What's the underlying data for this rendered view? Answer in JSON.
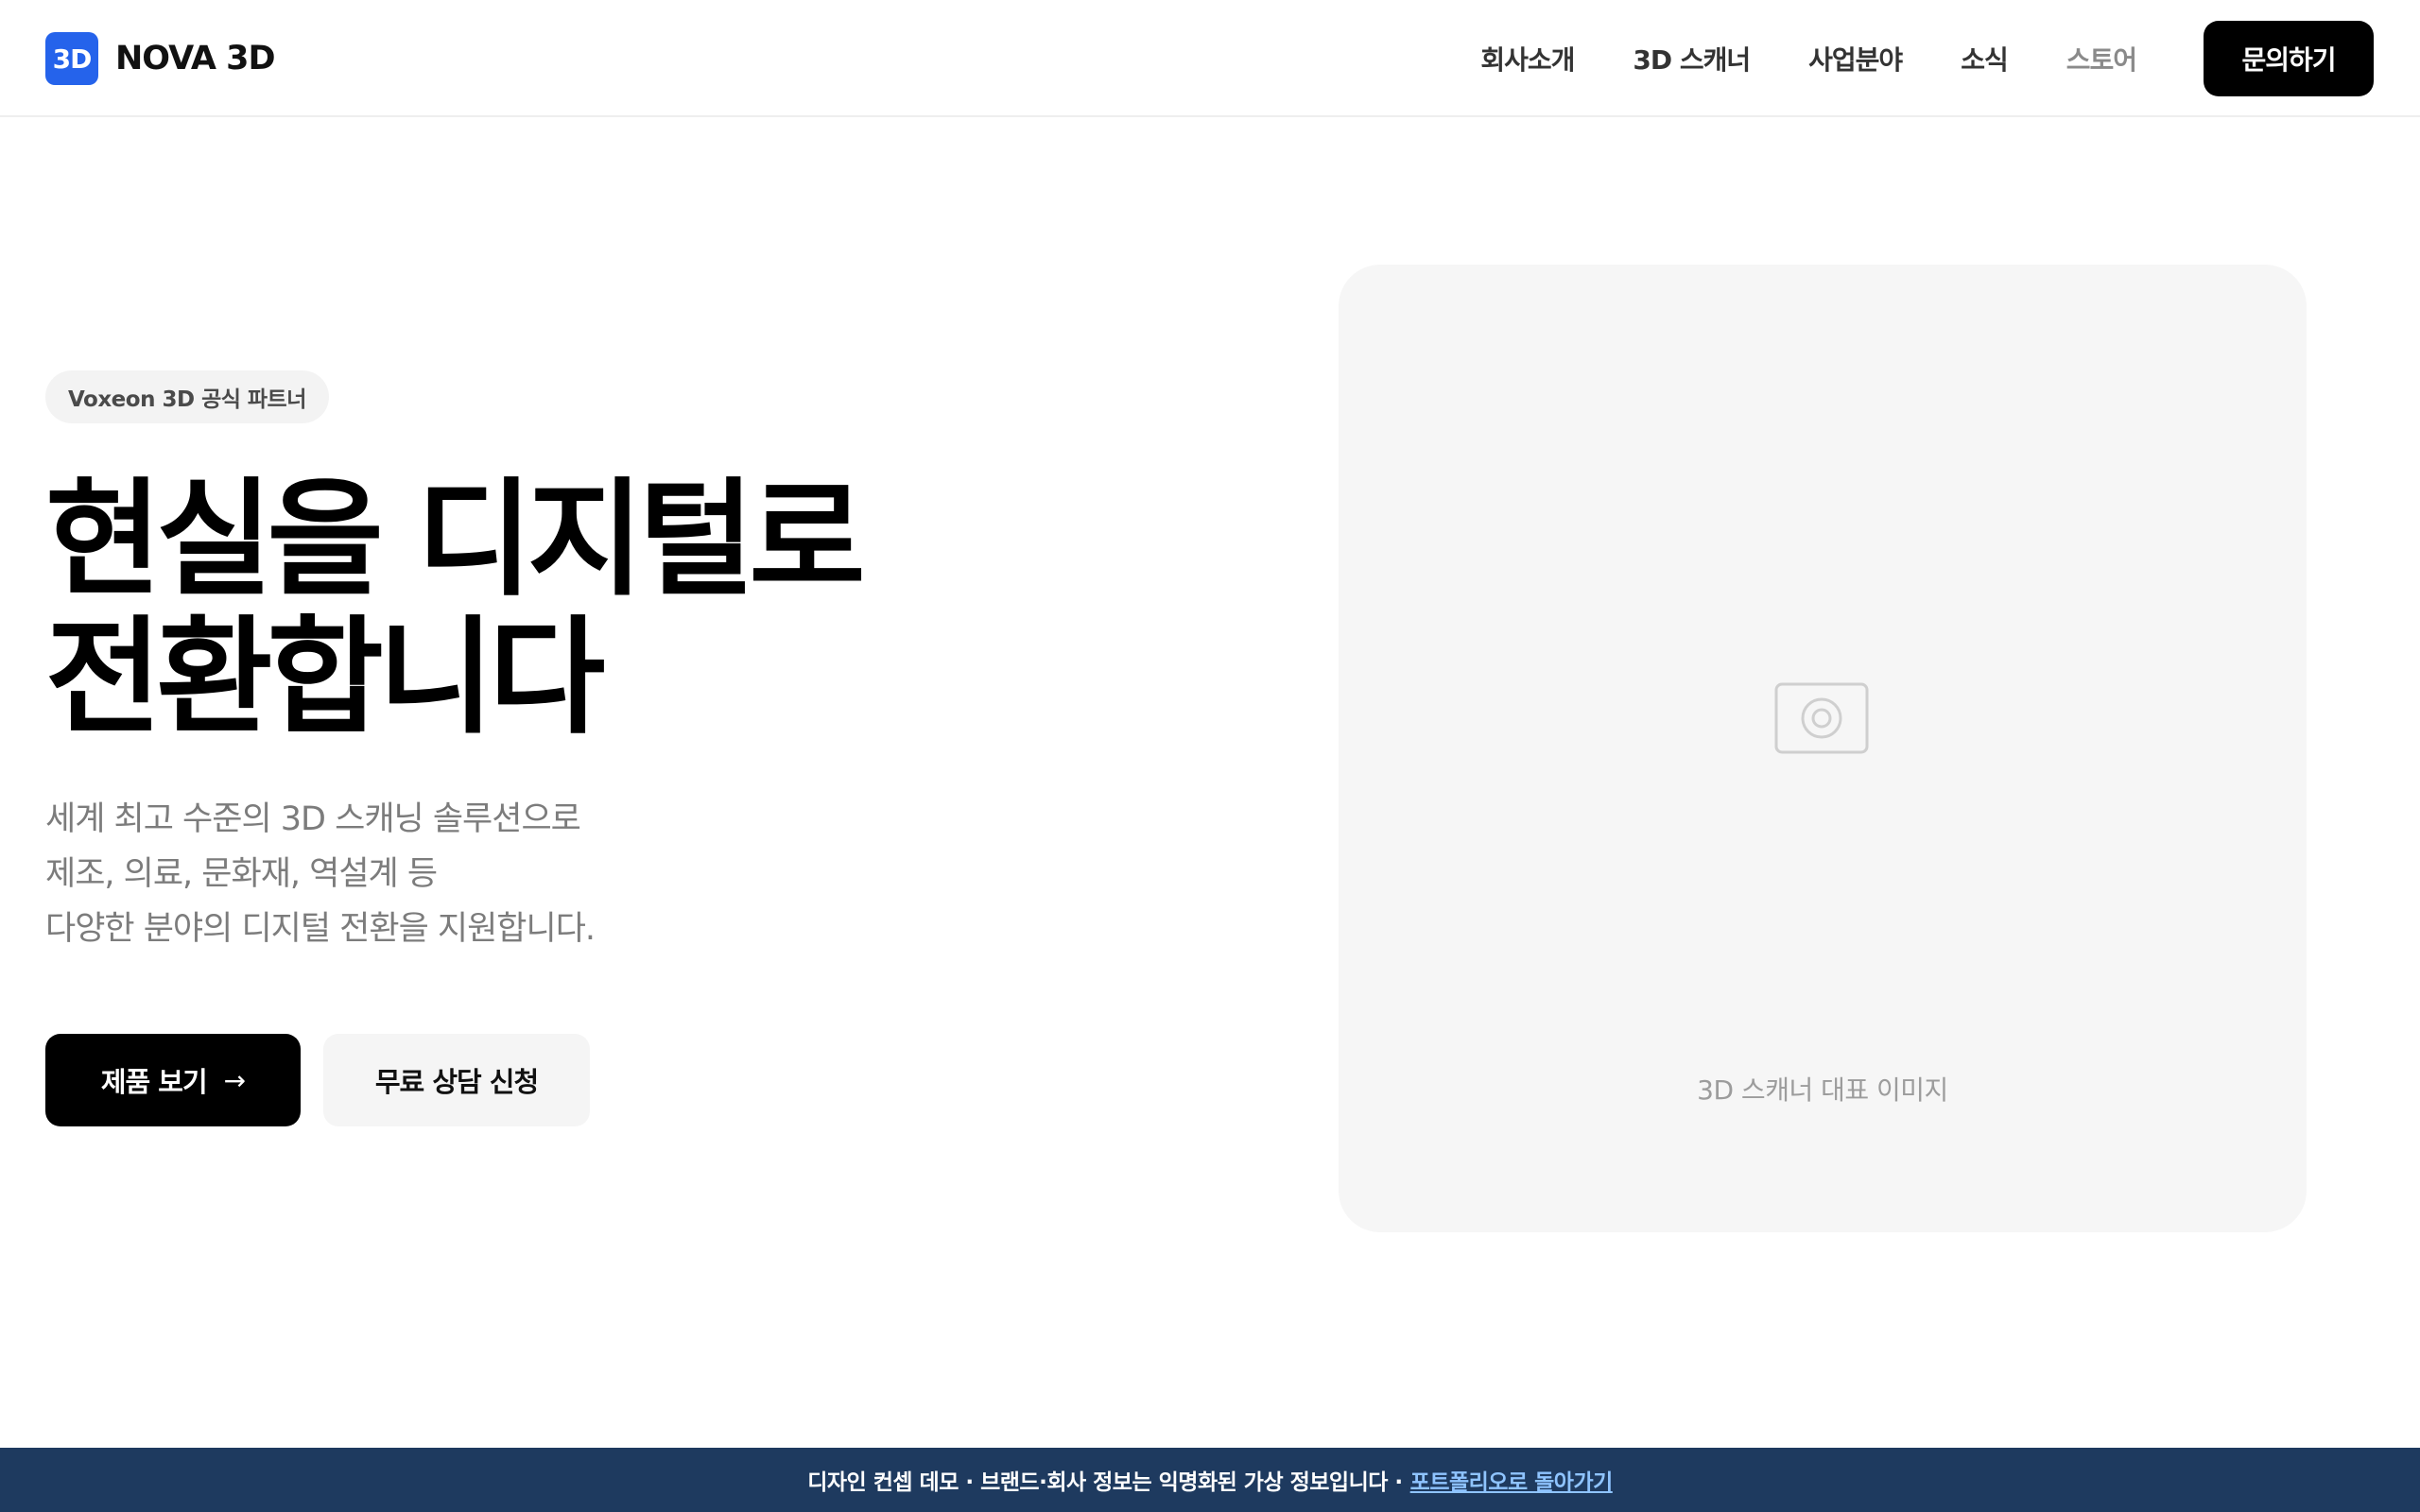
{
  "brand": {
    "badge": "3D",
    "name": "NOVA 3D",
    "badge_color": "#2563eb"
  },
  "nav": {
    "items": [
      {
        "label": "회사소개"
      },
      {
        "label": "3D 스캐너"
      },
      {
        "label": "사업분야"
      },
      {
        "label": "소식"
      },
      {
        "label": "스토어"
      }
    ],
    "cta_label": "문의하기"
  },
  "hero": {
    "badge": "Voxeon 3D 공식 파트너",
    "headline_lines": [
      "현실을 디지털로",
      "전환합니다"
    ],
    "subcopy_lines": [
      "세계 최고 수준의 3D 스캐닝 솔루션으로",
      "제조, 의료, 문화재, 역설계 등",
      "다양한 분야의 디지털 전환을 지원합니다."
    ],
    "primary_button": "제품 보기",
    "primary_button_icon": "arrow-right-icon",
    "secondary_button": "무료 상담 신청",
    "image_placeholder_label": "3D 스캐너 대표 이미지",
    "image_placeholder_icon": "camera-icon"
  },
  "footer": {
    "notice": "디자인 컨셉 데모 · 브랜드·회사 정보는 익명화된 가상 정보입니다 ·",
    "link_label": "포트폴리오로 돌아가기",
    "background_color": "#1e3a5f",
    "link_color": "#8fc4ff"
  }
}
